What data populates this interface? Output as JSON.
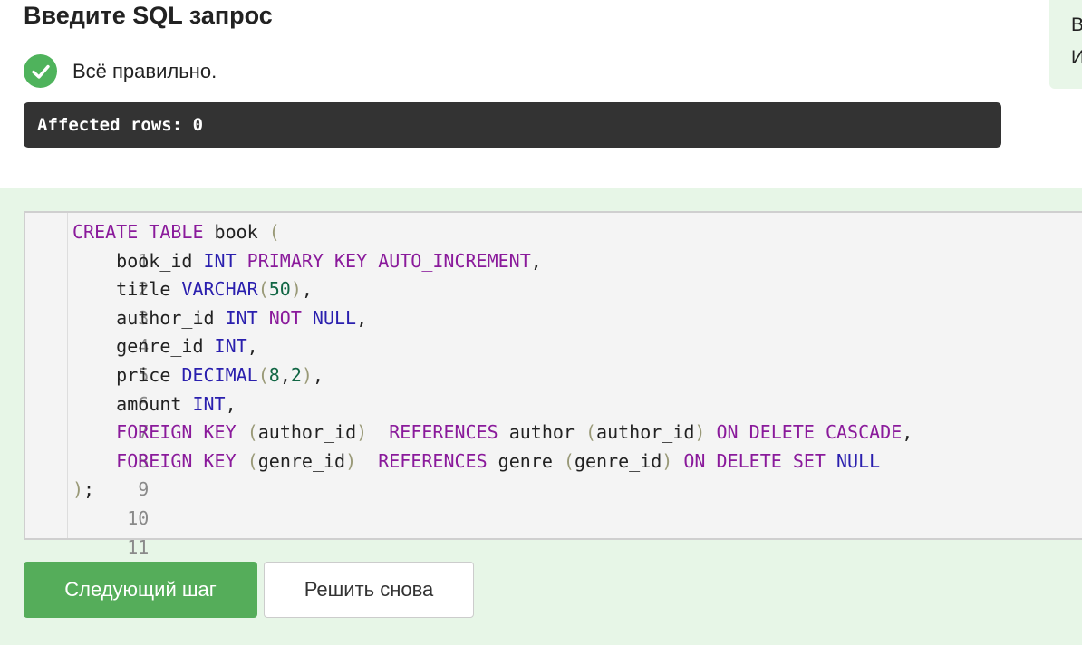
{
  "header": {
    "title": "Введите SQL запрос"
  },
  "side_panel": {
    "line1": "В",
    "line2": "И"
  },
  "status": {
    "icon": "check-circle-icon",
    "text": "Всё правильно."
  },
  "result": {
    "text": "Affected rows: 0"
  },
  "editor": {
    "lines": [
      {
        "n": "1"
      },
      {
        "n": "2"
      },
      {
        "n": "3"
      },
      {
        "n": "4"
      },
      {
        "n": "5"
      },
      {
        "n": "6"
      },
      {
        "n": "7"
      },
      {
        "n": "8"
      },
      {
        "n": "9"
      },
      {
        "n": "10"
      },
      {
        "n": "11"
      }
    ],
    "tokens": {
      "create": "CREATE",
      "table": "TABLE",
      "book": " book ",
      "open": "(",
      "book_id": "    book_id ",
      "int": "INT",
      "primary": "PRIMARY",
      "key": "KEY",
      "auto_inc": "AUTO_INCREMENT",
      "comma": ",",
      "title": "    title ",
      "varchar": "VARCHAR",
      "fifty": "50",
      "close": ")",
      "author_id": "    author_id ",
      "not": "NOT",
      "null": "NULL",
      "genre_id": "    genre_id ",
      "price": "    price ",
      "decimal": "DECIMAL",
      "eight": "8",
      "two": "2",
      "amount": "    amount ",
      "foreign": "FOREIGN",
      "author_id_ref": "author_id",
      "references": "REFERENCES",
      "author": " author ",
      "on": "ON",
      "delete": "DELETE",
      "cascade": "CASCADE",
      "genre_id_ref": "genre_id",
      "genre": " genre ",
      "set": "SET",
      "semicolon": ";"
    }
  },
  "buttons": {
    "next": "Следующий шаг",
    "again": "Решить снова"
  },
  "colors": {
    "accent_green": "#55ad5a",
    "check_green": "#4fb35c",
    "panel_bg": "#e7f6e7",
    "result_bg": "#333333",
    "keyword": "#8a1a9b",
    "type": "#2a1fae",
    "number": "#116644"
  }
}
